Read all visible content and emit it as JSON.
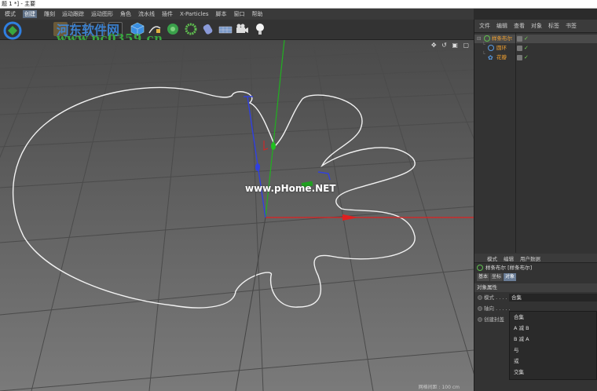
{
  "window": {
    "title": "题 1 *] - 主要"
  },
  "menu": [
    "模式",
    "创建",
    "雕刻",
    "运动跟踪",
    "运动图形",
    "角色",
    "流水线",
    "插件",
    "X-Particles",
    "脚本",
    "窗口",
    "帮助"
  ],
  "watermark": {
    "cn": "河东软件网",
    "url": "www.pc0359.cn",
    "viewport": "www.pHome.NET"
  },
  "viewport": {
    "nav_icons": "✥ ↺ ▣ ▢",
    "status": "网格间距 : 100 cm"
  },
  "object_manager": {
    "tabs": [
      "文件",
      "编辑",
      "查看",
      "对象",
      "标签",
      "书签"
    ],
    "objects": [
      {
        "name": "样条布尔",
        "icon": "spline-boolean-icon"
      },
      {
        "name": "圆环",
        "icon": "circle-spline-icon"
      },
      {
        "name": "花瓣",
        "icon": "flower-spline-icon"
      }
    ]
  },
  "attributes": {
    "tabs": [
      "模式",
      "编辑",
      "用户数据"
    ],
    "title": "样条布尔 [样条布尔]",
    "sub_tabs": [
      "基本",
      "坐标",
      "对象"
    ],
    "section": "对象属性",
    "params": [
      {
        "label": "模式 . . . . ."
      },
      {
        "label": "轴向 . . . . ."
      },
      {
        "label": "创建封盖"
      }
    ],
    "mode_value": "合集",
    "mode_options": [
      "合集",
      "A 减 B",
      "B 减 A",
      "与",
      "或",
      "交集"
    ]
  },
  "colors": {
    "accent": "#5d6f86",
    "x_axis": "#e02020",
    "y_axis": "#20c020",
    "z_axis": "#2030e0",
    "object_name": "#f0a030"
  }
}
